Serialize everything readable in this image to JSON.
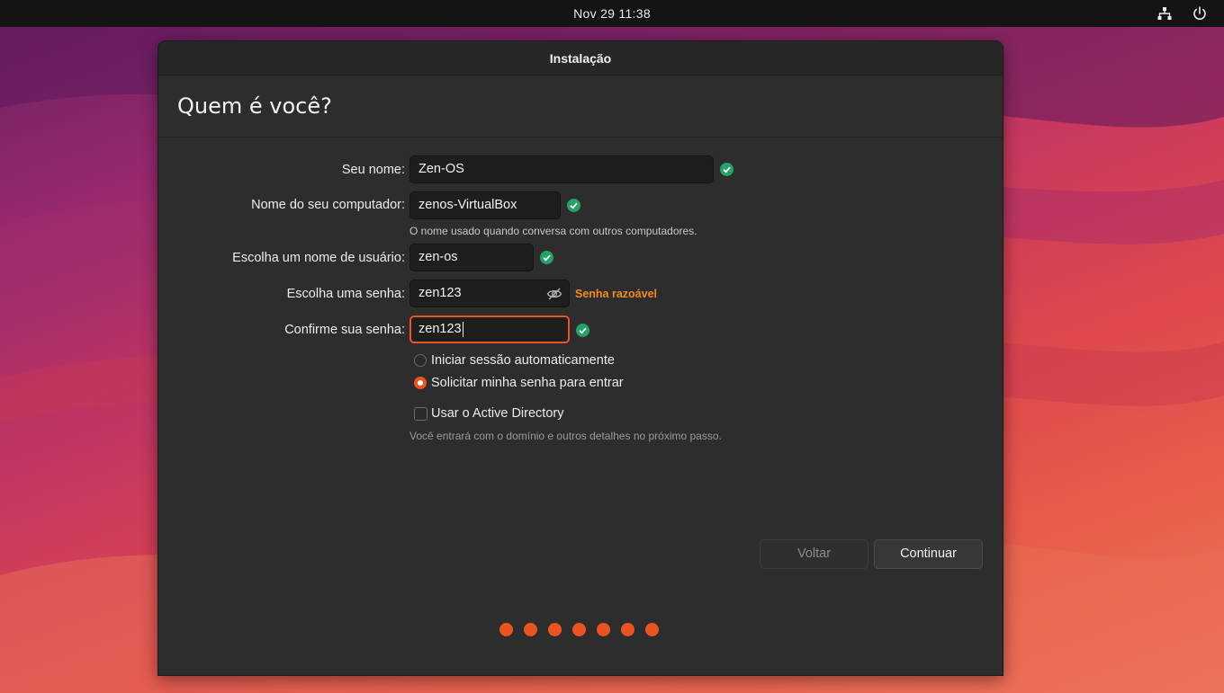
{
  "topbar": {
    "datetime": "Nov 29  11:38",
    "icons": [
      "network-wired-icon",
      "power-icon"
    ]
  },
  "window": {
    "title": "Instalação",
    "heading": "Quem é você?"
  },
  "form": {
    "name": {
      "label": "Seu nome:",
      "value": "Zen-OS",
      "valid": true
    },
    "computer": {
      "label": "Nome do seu computador:",
      "value": "zenos-VirtualBox",
      "valid": true,
      "hint": "O nome usado quando conversa com outros computadores."
    },
    "username": {
      "label": "Escolha um nome de usuário:",
      "value": "zen-os",
      "valid": true
    },
    "password": {
      "label": "Escolha uma senha:",
      "value": "zen123",
      "strength": "Senha razoável"
    },
    "confirm": {
      "label": "Confirme sua senha:",
      "value": "zen123",
      "valid": true
    }
  },
  "login_options": [
    {
      "label": "Iniciar sessão automaticamente",
      "selected": false
    },
    {
      "label": "Solicitar minha senha para entrar",
      "selected": true
    }
  ],
  "active_directory": {
    "label": "Usar o Active Directory",
    "checked": false,
    "hint": "Você entrará com o domínio e outros detalhes no próximo passo."
  },
  "buttons": {
    "back": "Voltar",
    "continue": "Continuar"
  },
  "progress": {
    "total_steps": 7,
    "completed_steps": 7
  },
  "colors": {
    "accent": "#e95420",
    "success": "#26a269",
    "warning": "#f48a1e"
  }
}
